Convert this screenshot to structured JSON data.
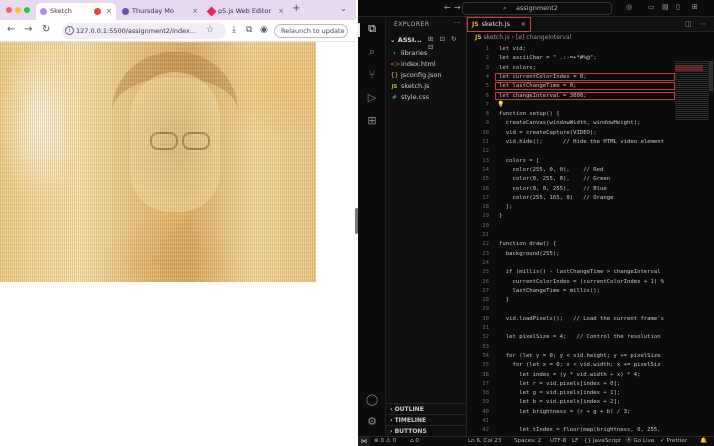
{
  "browser": {
    "tabs": [
      {
        "label": "Sketch",
        "active": true
      },
      {
        "label": "Thursday Mo"
      },
      {
        "label": "p5.js Web Editor"
      }
    ],
    "new_tab": "+",
    "tabs_menu": "⌄",
    "nav": {
      "back": "←",
      "forward": "→",
      "reload": "↻"
    },
    "url": "127.0.0.1:5500/assignment2/index...",
    "relaunch": "Relaunch to update",
    "colors": {
      "tabbar": "#e7d9f1",
      "red_light": "#ff5f57",
      "yellow_light": "#febc2e",
      "green_light": "#28c840"
    }
  },
  "vscode": {
    "nav_back": "←",
    "nav_forward": "→",
    "search": "assignment2",
    "explorer_title": "EXPLORER",
    "more": "···",
    "folder": "ASSI...",
    "folder_actions": "⊞ ⊡ ↻ ⊟",
    "files": [
      {
        "name": "libraries",
        "icon": "›"
      },
      {
        "name": "index.html",
        "icon": "<>"
      },
      {
        "name": "jsconfig.json",
        "icon": "{}"
      },
      {
        "name": "sketch.js",
        "icon": "JS"
      },
      {
        "name": "style.css",
        "icon": "#"
      }
    ],
    "sections": {
      "outline": "OUTLINE",
      "timeline": "TIMELINE",
      "buttons": "BUTTONS"
    },
    "open_tab": "sketch.js",
    "js_badge": "JS",
    "breadcrumb": "sketch.js › [ø] changeInterval",
    "code_lines": [
      {
        "n": "1",
        "t": "let vid;"
      },
      {
        "n": "2",
        "t": "let asciiChar = \" .:-=+*#%@\";"
      },
      {
        "n": "3",
        "t": "let colors;"
      },
      {
        "n": "4",
        "t": "let currentColorIndex = 0;"
      },
      {
        "n": "5",
        "t": "let lastChangeTime = 0;"
      },
      {
        "n": "6",
        "t": "let changeInterval = 3000;"
      },
      {
        "n": "7",
        "t": ""
      },
      {
        "n": "8",
        "t": "function setup() {"
      },
      {
        "n": "9",
        "t": "  createCanvas(windowWidth, windowHeight);"
      },
      {
        "n": "10",
        "t": "  vid = createCapture(VIDEO);"
      },
      {
        "n": "11",
        "t": "  vid.hide();      // Hide the HTML video element"
      },
      {
        "n": "12",
        "t": ""
      },
      {
        "n": "13",
        "t": "  colors = ["
      },
      {
        "n": "14",
        "t": "    color(255, 0, 0),    // Red"
      },
      {
        "n": "15",
        "t": "    color(0, 255, 0),    // Green"
      },
      {
        "n": "16",
        "t": "    color(0, 0, 255),    // Blue"
      },
      {
        "n": "17",
        "t": "    color(255, 165, 0)   // Orange"
      },
      {
        "n": "18",
        "t": "  ];"
      },
      {
        "n": "19",
        "t": "}"
      },
      {
        "n": "20",
        "t": ""
      },
      {
        "n": "21",
        "t": ""
      },
      {
        "n": "22",
        "t": "function draw() {"
      },
      {
        "n": "23",
        "t": "  background(255);"
      },
      {
        "n": "24",
        "t": ""
      },
      {
        "n": "25",
        "t": "  if (millis() - lastChangeTime > changeInterval"
      },
      {
        "n": "26",
        "t": "    currentColorIndex = (currentColorIndex + 1) %"
      },
      {
        "n": "27",
        "t": "    lastChangeTime = millis();"
      },
      {
        "n": "28",
        "t": "  }"
      },
      {
        "n": "29",
        "t": ""
      },
      {
        "n": "30",
        "t": "  vid.loadPixels();   // Load the current frame's"
      },
      {
        "n": "31",
        "t": ""
      },
      {
        "n": "32",
        "t": "  let pixelSize = 4;   // Control the resolution"
      },
      {
        "n": "33",
        "t": ""
      },
      {
        "n": "34",
        "t": "  for (let y = 0; y < vid.height; y += pixelSize"
      },
      {
        "n": "35",
        "t": "    for (let x = 0; x < vid.width; x += pixelSiz"
      },
      {
        "n": "36",
        "t": "      let index = (y * vid.width + x) * 4;"
      },
      {
        "n": "37",
        "t": "      let r = vid.pixels[index + 0];"
      },
      {
        "n": "38",
        "t": "      let g = vid.pixels[index + 1];"
      },
      {
        "n": "39",
        "t": "      let b = vid.pixels[index + 2];"
      },
      {
        "n": "40",
        "t": "      let brightness = (r + g + b) / 3;"
      },
      {
        "n": "41",
        "t": ""
      },
      {
        "n": "42",
        "t": "      let tIndex = floor(map(brightness, 0, 255,"
      }
    ],
    "status": {
      "remote": "⋈",
      "problems": "⊗ 0 ⚠ 0",
      "ports": "⌂ 0",
      "position": "Ln 6, Col 23",
      "spaces": "Spaces: 2",
      "encoding": "UTF-8",
      "eol": "LF",
      "language": "{} JavaScript",
      "golive": "⦿ Go Live",
      "prettier": "✓ Prettier",
      "bell": "🔔"
    }
  }
}
